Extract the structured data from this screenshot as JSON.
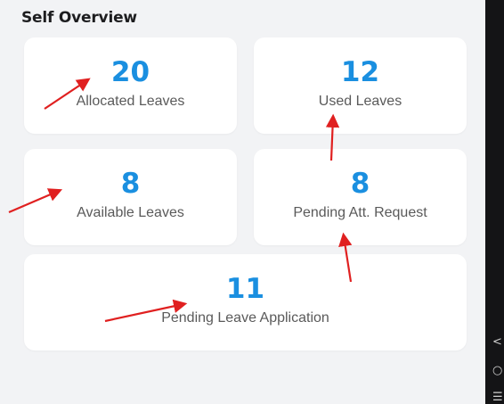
{
  "section": {
    "title": "Self Overview"
  },
  "cards": [
    {
      "value": "20",
      "label": "Allocated Leaves"
    },
    {
      "value": "12",
      "label": "Used Leaves"
    },
    {
      "value": "8",
      "label": "Available Leaves"
    },
    {
      "value": "8",
      "label": "Pending Att. Request"
    },
    {
      "value": "11",
      "label": "Pending Leave Application"
    }
  ],
  "colors": {
    "value_blue": "#1a8fe0",
    "annotation_red": "#e02020",
    "card_bg": "#ffffff",
    "page_bg": "#f2f3f5"
  },
  "nav_icons": [
    "back-chevron-icon",
    "home-circle-icon",
    "recents-icon"
  ]
}
